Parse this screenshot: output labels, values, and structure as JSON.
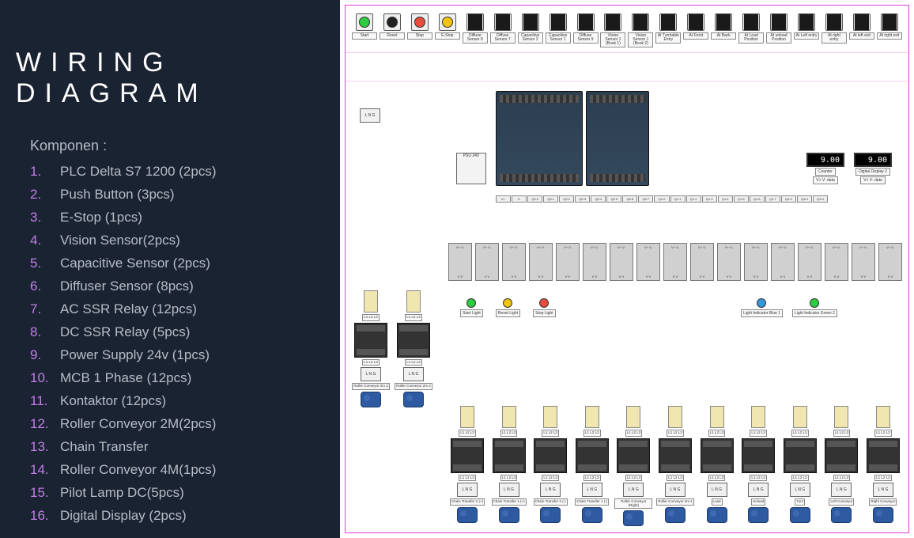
{
  "title": "WIRING DIAGRAM",
  "komponen_label": "Komponen :",
  "components": [
    {
      "n": "1.",
      "t": "PLC Delta S7 1200 (2pcs)"
    },
    {
      "n": "2.",
      "t": "Push Button (3pcs)"
    },
    {
      "n": "3.",
      "t": "E-Stop (1pcs)"
    },
    {
      "n": "4.",
      "t": "Vision Sensor(2pcs)"
    },
    {
      "n": "5.",
      "t": "Capacitive Sensor (2pcs)"
    },
    {
      "n": "6.",
      "t": "Diffuser Sensor (8pcs)"
    },
    {
      "n": "7.",
      "t": "AC SSR Relay (12pcs)"
    },
    {
      "n": "8.",
      "t": "DC SSR Relay (5pcs)"
    },
    {
      "n": "9.",
      "t": "Power Supply 24v (1pcs)"
    },
    {
      "n": "10.",
      "t": "MCB 1 Phase (12pcs)"
    },
    {
      "n": "11.",
      "t": "Kontaktor (12pcs)"
    },
    {
      "n": "12.",
      "t": "Roller Conveyor 2M(2pcs)"
    },
    {
      "n": "13.",
      "t": "Chain Transfer"
    },
    {
      "n": "14.",
      "t": "Roller Conveyor 4M(1pcs)"
    },
    {
      "n": "15.",
      "t": "Pilot Lamp DC(5pcs)"
    },
    {
      "n": "16.",
      "t": "Digital Display (2pcs)"
    }
  ],
  "top_inputs": [
    {
      "label": "Start",
      "color": "green",
      "kind": "btn"
    },
    {
      "label": "Reset",
      "color": "black",
      "kind": "btn"
    },
    {
      "label": "Stop",
      "color": "red",
      "kind": "btn"
    },
    {
      "label": "E-Stop",
      "color": "yellow",
      "kind": "btn"
    },
    {
      "label": "Diffuse Sensor 8",
      "color": "dark",
      "kind": "sensor"
    },
    {
      "label": "Diffuse Sensor 7",
      "color": "dark",
      "kind": "sensor"
    },
    {
      "label": "Capacitive Sensor 2",
      "color": "grey",
      "kind": "sensor"
    },
    {
      "label": "Capacitive Sensor 1",
      "color": "grey",
      "kind": "sensor"
    },
    {
      "label": "Diffuse Sensor 9",
      "color": "dark",
      "kind": "sensor"
    },
    {
      "label": "Vision Sensor 1 (Book 1)",
      "color": "dark",
      "kind": "sensor"
    },
    {
      "label": "Vision Sensor 1 (Book 2)",
      "color": "dark",
      "kind": "sensor"
    },
    {
      "label": "At Turntable Entry",
      "color": "grey",
      "kind": "sensor"
    },
    {
      "label": "At Front",
      "color": "grey",
      "kind": "sensor"
    },
    {
      "label": "At Back",
      "color": "grey",
      "kind": "sensor"
    },
    {
      "label": "At Load Position",
      "color": "grey",
      "kind": "sensor"
    },
    {
      "label": "At unload Position",
      "color": "grey",
      "kind": "sensor"
    },
    {
      "label": "At Left entry",
      "color": "grey",
      "kind": "sensor"
    },
    {
      "label": "At right entry",
      "color": "grey",
      "kind": "sensor"
    },
    {
      "label": "At left exit",
      "color": "grey",
      "kind": "sensor"
    },
    {
      "label": "At right exit",
      "color": "grey",
      "kind": "sensor"
    }
  ],
  "lng_label": "L  N  G",
  "psu_label": "PSU 24V",
  "plc_terms": [
    "V+",
    "V-",
    "Q0.0",
    "Q0.1",
    "Q0.2",
    "Q0.3",
    "Q0.4",
    "Q0.5",
    "Q0.6",
    "Q0.7",
    "Q1.0",
    "Q1.1",
    "Q1.2",
    "Q1.3",
    "Q1.4",
    "Q1.5",
    "Q1.6",
    "Q1.7",
    "Q2.0",
    "Q3.0",
    "Q3.4"
  ],
  "ssr_count": 17,
  "ssr_top": "V+ V-",
  "ssr_bottom": "V  V",
  "lights": [
    {
      "label": "Start Light",
      "color": "green"
    },
    {
      "label": "Reset Light",
      "color": "yellow"
    },
    {
      "label": "Stop Light",
      "color": "red"
    }
  ],
  "lights2": [
    {
      "label": "Light Indicator Blue 1",
      "color": "blue"
    },
    {
      "label": "Light Indicator Green 2",
      "color": "green"
    }
  ],
  "contactor_top": "L1 L2 L3",
  "contactor_bottom": "L1 L2 L3",
  "left_motors": [
    {
      "label": "Roller Conveyor 2m 3"
    },
    {
      "label": "Roller Conveyor 2m 2"
    }
  ],
  "bottom_motors": [
    {
      "label": "Chain Transfer 2 (+)"
    },
    {
      "label": "Chain Transfer 1 (+)"
    },
    {
      "label": "Chain Transfer 2 (-)"
    },
    {
      "label": "Chain Transfer 1 (-)"
    },
    {
      "label": "Roller Conveyor (Right)"
    },
    {
      "label": "Roller Conveyor 4m 1"
    },
    {
      "label": "Load"
    },
    {
      "label": "Unload"
    },
    {
      "label": "Turn"
    },
    {
      "label": "Left Conveyor"
    },
    {
      "label": "Right Conveyor"
    }
  ],
  "counters": [
    {
      "value": "9.00",
      "label": "Counter"
    },
    {
      "value": "9.00",
      "label": "Digital Display 2"
    }
  ],
  "counter_pins": "V+ V- data"
}
